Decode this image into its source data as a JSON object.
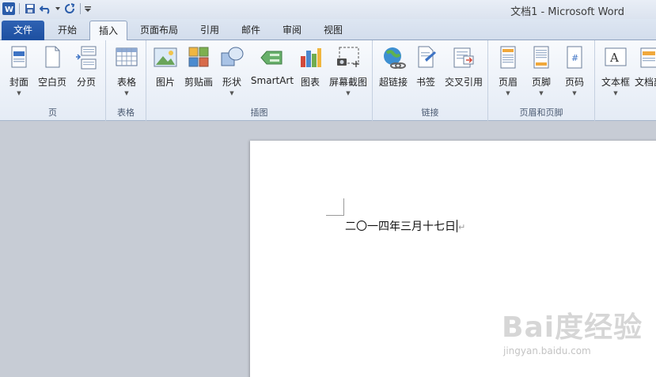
{
  "window": {
    "title": "文档1 - Microsoft Word"
  },
  "tabs": [
    {
      "label": "文件"
    },
    {
      "label": "开始"
    },
    {
      "label": "插入"
    },
    {
      "label": "页面布局"
    },
    {
      "label": "引用"
    },
    {
      "label": "邮件"
    },
    {
      "label": "审阅"
    },
    {
      "label": "视图"
    }
  ],
  "groups": {
    "pages": {
      "label": "页",
      "buttons": [
        "封面",
        "空白页",
        "分页"
      ]
    },
    "tables": {
      "label": "表格",
      "buttons": [
        "表格"
      ]
    },
    "illustrations": {
      "label": "插图",
      "buttons": [
        "图片",
        "剪贴画",
        "形状",
        "SmartArt",
        "图表",
        "屏幕截图"
      ]
    },
    "links": {
      "label": "链接",
      "buttons": [
        "超链接",
        "书签",
        "交叉引用"
      ]
    },
    "header_footer": {
      "label": "页眉和页脚",
      "buttons": [
        "页眉",
        "页脚",
        "页码"
      ]
    },
    "text": {
      "buttons": [
        "文本框",
        "文档部"
      ]
    }
  },
  "document": {
    "text": "二〇一四年三月十七日",
    "paragraph_mark": "↵"
  },
  "watermark": {
    "main": "Bai度经验",
    "sub": "jingyan.baidu.com"
  },
  "colors": {
    "file_tab": "#2a5caa",
    "doc_bg": "#c7ccd5",
    "ribbon_top": "#f8fafd"
  }
}
